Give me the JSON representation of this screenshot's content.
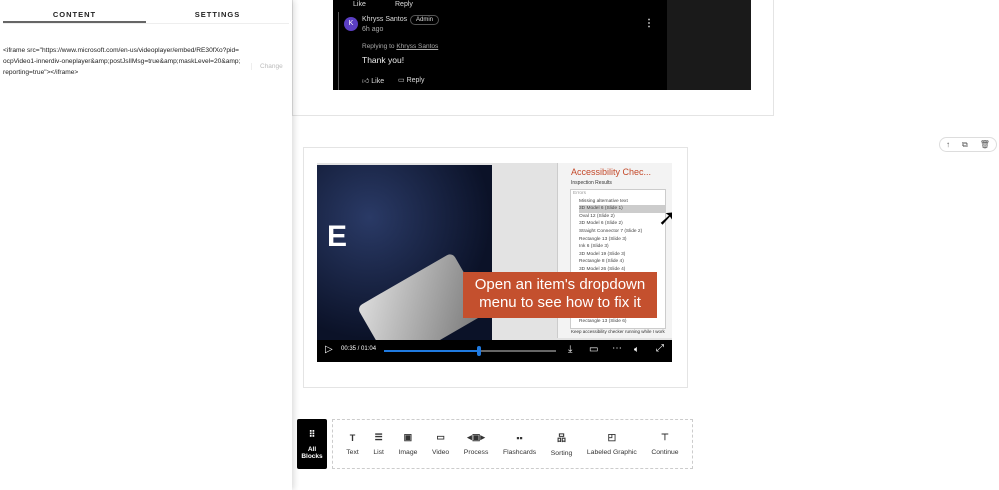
{
  "panel": {
    "tabs": [
      "CONTENT",
      "SETTINGS"
    ],
    "embed_code": "<iframe src=\"https://www.microsoft.com/en-us/videoplayer/embed/RE30fXo?pid=ocpVideo1-innerdiv-oneplayer&amp;postJslIMsg=true&amp;maskLevel=20&amp;reporting=true\"></iframe>",
    "change_label": "Change"
  },
  "comment": {
    "prev_like": "Like",
    "prev_reply": "Reply",
    "avatar_initial": "K",
    "author": "Khryss Santos",
    "badge": "Admin",
    "time": "6h ago",
    "replying_prefix": "Replying to",
    "replying_to": "Khryss Santos",
    "text": "Thank you!",
    "like": "Like",
    "reply": "Reply"
  },
  "video": {
    "panel_title": "Accessibility Chec...",
    "inspection": "Inspection Results",
    "errors": "Errors",
    "group": "Missing alternative text",
    "items": [
      "3D Model 6 (Slide 1)",
      "Oval 12 (Slide 2)",
      "3D Model 6 (Slide 2)",
      "Straight Connector 7 (Slide 2)",
      "Rectangle 13 (Slide 3)",
      "Ink 6 (Slide 3)",
      "3D Model 19 (Slide 3)",
      "Rectangle 8 (Slide 4)",
      "3D Model 26 (Slide 4)"
    ],
    "last_item": "Rectangle 13 (Slide 6)",
    "keep": "Keep accessibility checker running while I work",
    "letter": "E",
    "caption_line1": "Open an item's dropdown",
    "caption_line2": "menu to see how to fix it",
    "time": "00:35 / 01:04",
    "progress": 0.55
  },
  "toolbar": {
    "all_blocks_line1": "All",
    "all_blocks_line2": "Blocks",
    "blocks": [
      {
        "icon": "T",
        "label": "Text"
      },
      {
        "icon": "☰",
        "label": "List"
      },
      {
        "icon": "▣",
        "label": "Image"
      },
      {
        "icon": "▭",
        "label": "Video"
      },
      {
        "icon": "◂▣▸",
        "label": "Process"
      },
      {
        "icon": "▪▪",
        "label": "Flashcards"
      },
      {
        "icon": "品",
        "label": "Sorting"
      },
      {
        "icon": "◰",
        "label": "Labeled Graphic"
      },
      {
        "icon": "⊤",
        "label": "Continue"
      }
    ]
  }
}
